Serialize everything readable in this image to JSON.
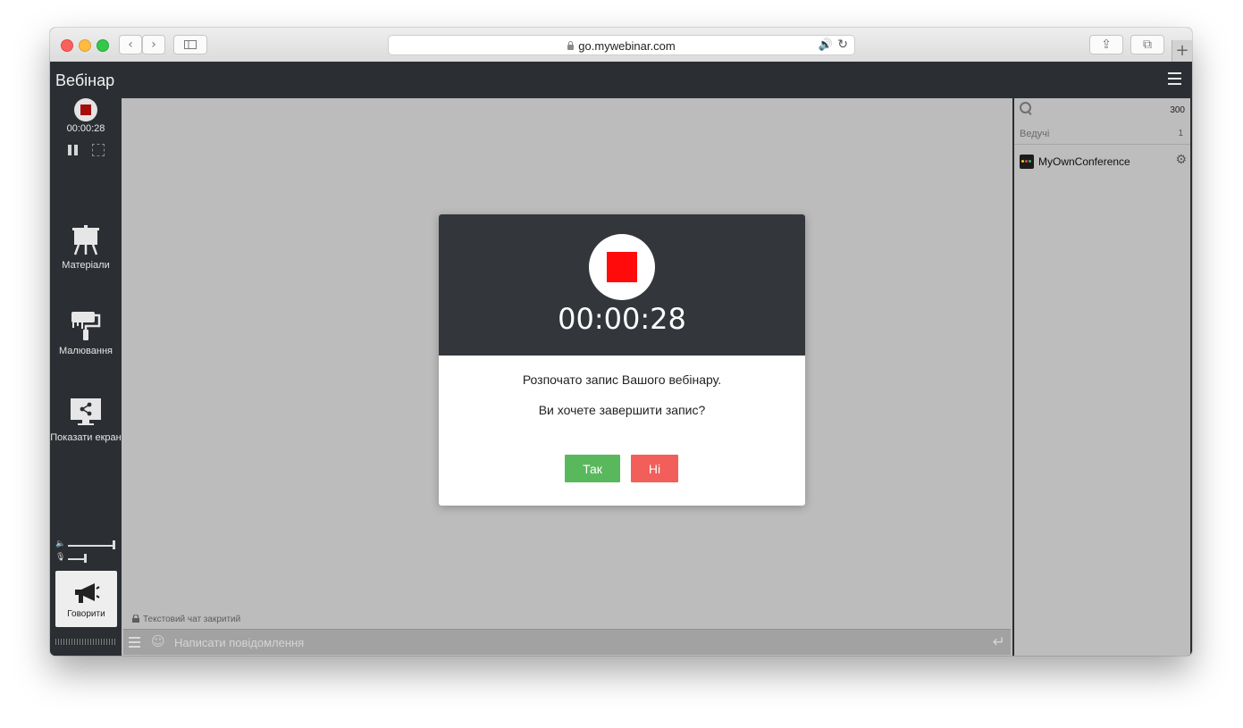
{
  "browser": {
    "url": "go.mywebinar.com",
    "back_glyph": "‹",
    "forward_glyph": "›",
    "share_glyph": "⇪",
    "tabs_glyph": "⧉",
    "new_tab_glyph": "+",
    "speaker_glyph": "🔊",
    "reload_glyph": "↻"
  },
  "app": {
    "title": "Вебінар"
  },
  "recording": {
    "time": "00:00:28"
  },
  "sidebar": {
    "tools": [
      {
        "label": "Матеріали"
      },
      {
        "label": "Малювання"
      },
      {
        "label": "Показати екран"
      }
    ],
    "speak_label": "Говорити",
    "volume": {
      "speaker": 1.0,
      "mic": 0.35
    }
  },
  "chat": {
    "closed_note": "Текстовий чат закритий",
    "placeholder": "Написати повідомлення",
    "smile_glyph": "☺",
    "enter_glyph": "↵"
  },
  "modal": {
    "time": "00:00:28",
    "message": "Розпочато запис Вашого вебінару.",
    "question": "Ви хочете завершити запис?",
    "yes_label": "Так",
    "no_label": "Ні"
  },
  "participants": {
    "count": "300",
    "section_label": "Ведучі",
    "section_count": "1",
    "users": [
      {
        "name": "MyOwnConference"
      }
    ],
    "gear_glyph": "⚙"
  },
  "colors": {
    "dark": "#2b2e32",
    "stage": "#bcbcbc",
    "record_red": "#ff0b0b",
    "yes_green": "#59b85c",
    "no_red": "#f25e5a"
  }
}
